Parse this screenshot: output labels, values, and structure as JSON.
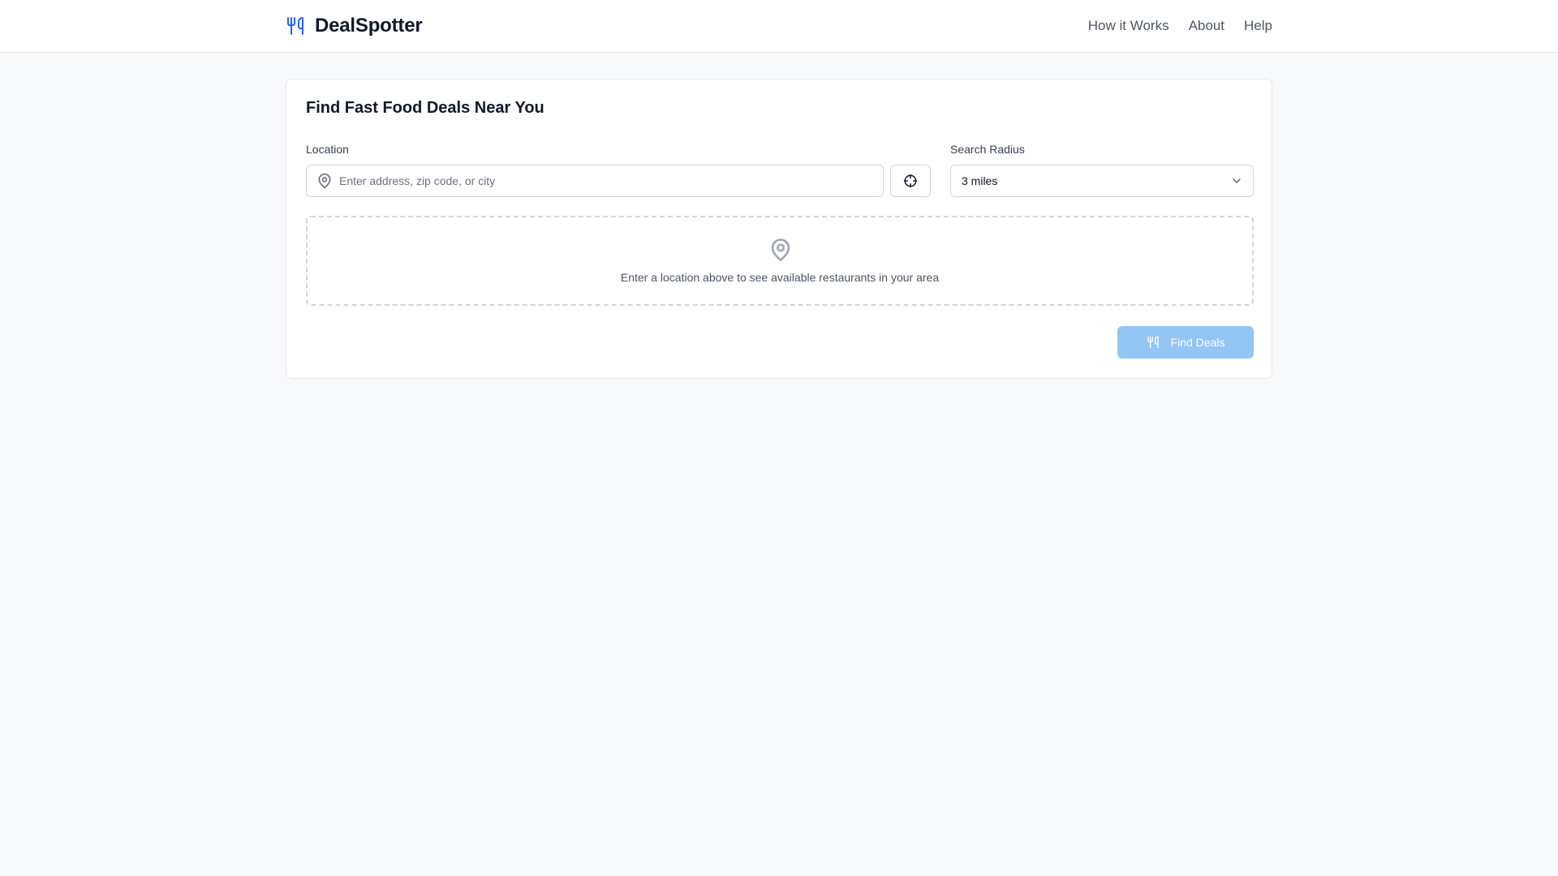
{
  "app": {
    "name": "DealSpotter",
    "brand_color": "#2563eb",
    "brand_icon": "utensils-icon"
  },
  "nav": {
    "items": [
      {
        "label": "How it Works"
      },
      {
        "label": "About"
      },
      {
        "label": "Help"
      }
    ]
  },
  "search": {
    "title": "Find Fast Food Deals Near You",
    "location_label": "Location",
    "location_placeholder": "Enter address, zip code, or city",
    "location_value": "",
    "location_icon": "map-pin-icon",
    "locate_icon": "crosshair-icon",
    "radius_label": "Search Radius",
    "radius_value": "3 miles",
    "radius_icon": "chevron-down-icon",
    "empty_state_icon": "map-pin-icon",
    "empty_state_message": "Enter a location above to see available restaurants in your area",
    "submit_label": "Find Deals",
    "submit_icon": "utensils-icon",
    "submit_color": "#93c5f5",
    "submit_disabled": true
  }
}
